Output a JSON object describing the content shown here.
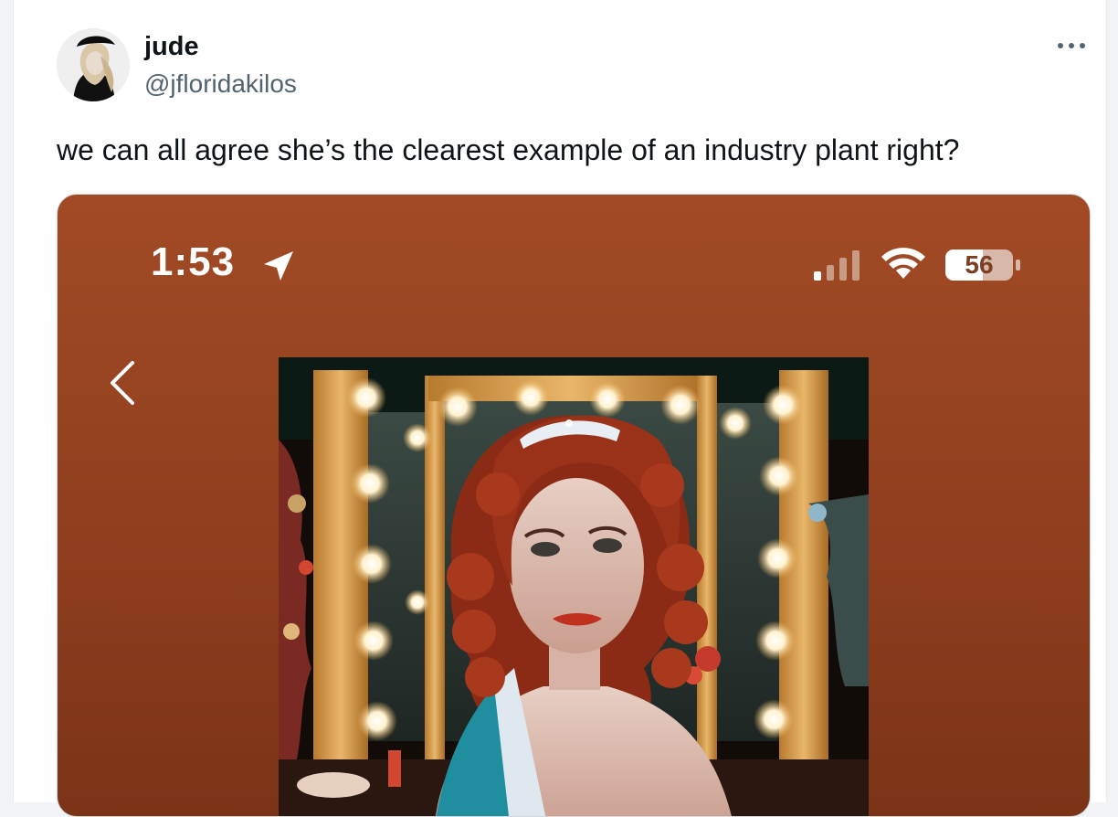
{
  "tweet": {
    "author_name": "jude",
    "author_handle": "@jfloridakilos",
    "text": "we can all agree she’s the clearest example of an industry plant right?",
    "more_icon": "more-horizontal-icon"
  },
  "media": {
    "status_bar": {
      "time": "1:53",
      "battery_percent": "56",
      "battery_level": 0.56,
      "icons": [
        "location-arrow-icon",
        "cellular-signal-icon",
        "wifi-icon",
        "battery-icon"
      ]
    },
    "back_icon": "chevron-left-icon",
    "photo_description_icon": "album-cover-image"
  },
  "colors": {
    "media_background": "#a24a25",
    "text_primary": "#0f1419",
    "text_secondary": "#536471"
  }
}
